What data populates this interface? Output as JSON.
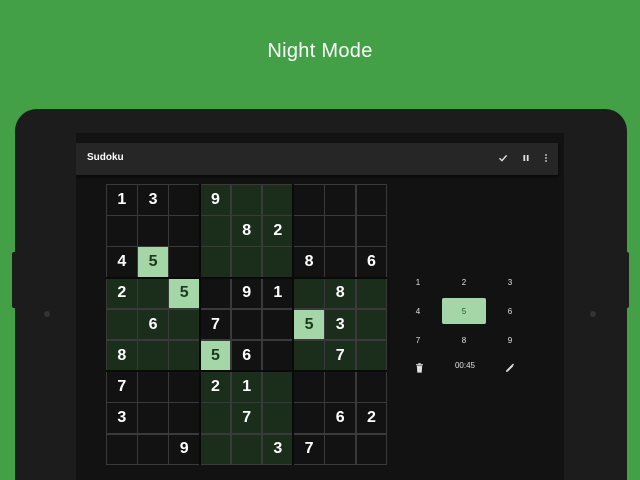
{
  "headline": "Night Mode",
  "app": {
    "title": "Sudoku",
    "icons": [
      "check-icon",
      "pause-icon",
      "more-vert-icon"
    ]
  },
  "board": {
    "grid": [
      [
        "1",
        "3",
        "",
        "9",
        "",
        "",
        "",
        "",
        ""
      ],
      [
        "",
        "",
        "",
        "",
        "8",
        "2",
        "",
        "",
        ""
      ],
      [
        "4",
        "5",
        "",
        "",
        "",
        "",
        "8",
        "",
        "6"
      ],
      [
        "2",
        "",
        "5",
        "",
        "9",
        "1",
        "",
        "8",
        ""
      ],
      [
        "",
        "6",
        "",
        "7",
        "",
        "",
        "5",
        "3",
        ""
      ],
      [
        "8",
        "",
        "",
        "5",
        "6",
        "",
        "",
        "7",
        ""
      ],
      [
        "7",
        "",
        "",
        "2",
        "1",
        "",
        "",
        "",
        ""
      ],
      [
        "3",
        "",
        "",
        "",
        "7",
        "",
        "",
        "6",
        "2"
      ],
      [
        "",
        "",
        "9",
        "",
        "",
        "3",
        "7",
        "",
        ""
      ]
    ],
    "selected_digit": "5",
    "colors": {
      "match": "#a5d6a7",
      "tinted": "#1a2e1b",
      "base": "#121212"
    }
  },
  "numpad": {
    "keys": [
      "1",
      "2",
      "3",
      "4",
      "5",
      "6",
      "7",
      "8",
      "9"
    ],
    "selected": "5"
  },
  "controls": {
    "timer": "00:45",
    "delete_icon": "trash-icon",
    "pencil_icon": "pencil-icon"
  }
}
